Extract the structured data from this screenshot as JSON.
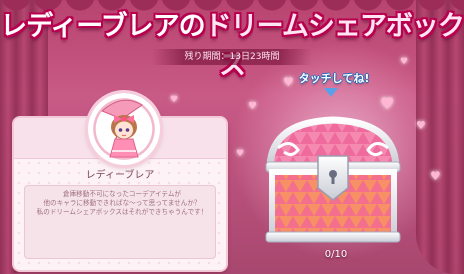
{
  "title": {
    "prefix": "レディーブレアの",
    "main": "ドリームシェアボックス"
  },
  "period": {
    "label": "残り期間：13日23時間"
  },
  "character": {
    "name": "レディーブレア",
    "description_lines": [
      "倉庫移動不可になったコーデアイテムが",
      "他のキャラに移動できればな～って思ってませんか？",
      "私のドリームシェアボックスはそれができちゃうんです！"
    ]
  },
  "chest": {
    "tap_label": "タッチしてね!",
    "counter": "0/10",
    "icon": "treasure-chest-icon"
  },
  "colors": {
    "title_outline": "#b9004f",
    "background": "#c85a86",
    "chest_pink": "#f37ea6",
    "tap_blue": "#2a6bb8"
  }
}
